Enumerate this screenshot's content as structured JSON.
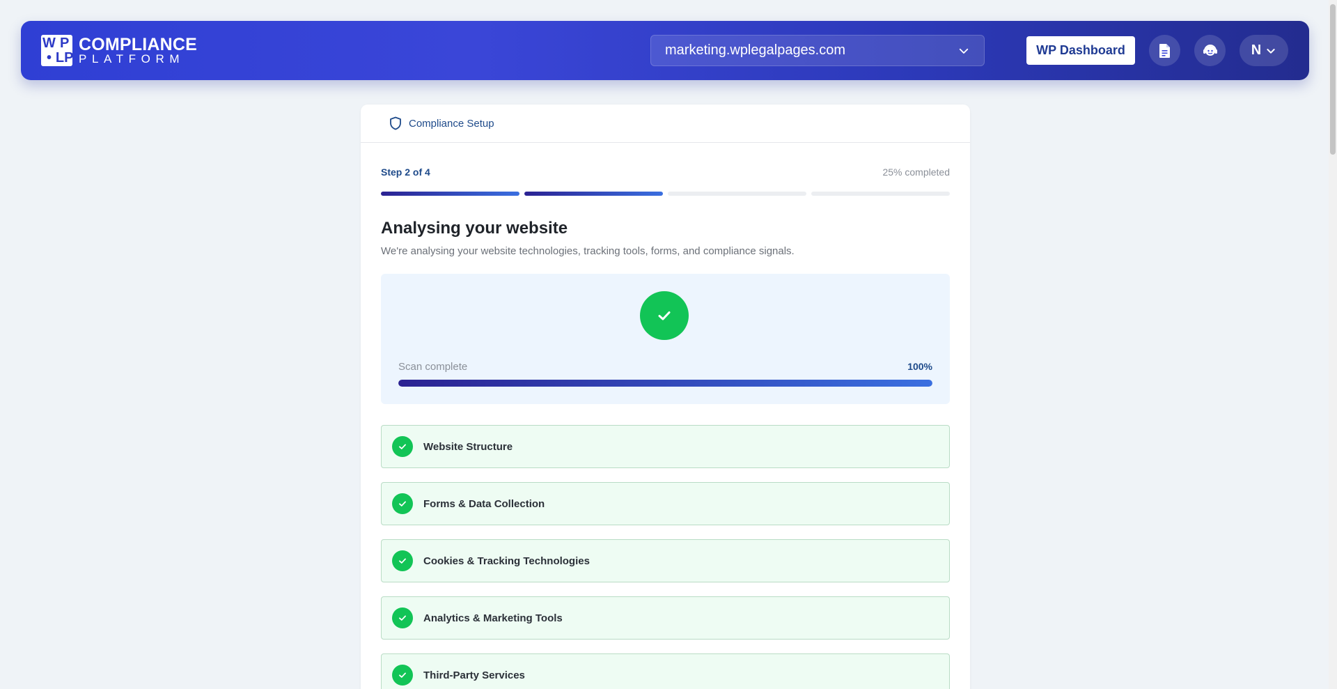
{
  "header": {
    "logo_mark": [
      "WP",
      "",
      "LP"
    ],
    "logo_line1": "COMPLIANCE",
    "logo_line2": "PLATFORM",
    "site_selected": "marketing.wplegalpages.com",
    "dashboard_label": "WP Dashboard",
    "user_initial": "N"
  },
  "card": {
    "header_title": "Compliance Setup",
    "step_label": "Step 2 of 4",
    "progress_label": "25% completed",
    "steps_total": 4,
    "steps_done": 2,
    "title": "Analysing your website",
    "subtitle": "We're analysing your website technologies, tracking tools, forms, and compliance signals.",
    "scan": {
      "label": "Scan complete",
      "percent_label": "100%",
      "percent": 100
    },
    "items": [
      {
        "label": "Website Structure"
      },
      {
        "label": "Forms & Data Collection"
      },
      {
        "label": "Cookies & Tracking Technologies"
      },
      {
        "label": "Analytics & Marketing Tools"
      },
      {
        "label": "Third-Party Services"
      }
    ]
  },
  "colors": {
    "brand": "#2f3fd4",
    "success": "#12c456",
    "accent_text": "#1e4a8a"
  }
}
